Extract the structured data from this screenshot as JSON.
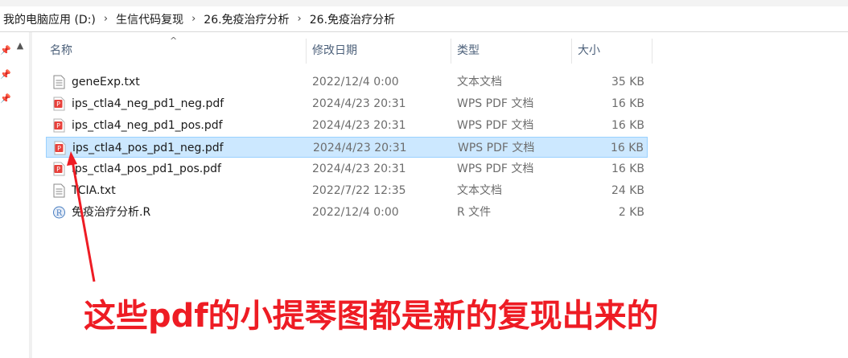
{
  "breadcrumb": {
    "items": [
      "我的电脑应用 (D:)",
      "生信代码复现",
      "26.免疫治疗分析",
      "26.免疫治疗分析"
    ],
    "separator": "›"
  },
  "columns": {
    "name": "名称",
    "date": "修改日期",
    "type": "类型",
    "size": "大小"
  },
  "files": [
    {
      "name": "geneExp.txt",
      "date": "2022/12/4 0:00",
      "type": "文本文档",
      "size": "35 KB",
      "icon": "text-file-icon",
      "selected": false
    },
    {
      "name": "ips_ctla4_neg_pd1_neg.pdf",
      "date": "2024/4/23 20:31",
      "type": "WPS PDF 文档",
      "size": "16 KB",
      "icon": "pdf-file-icon",
      "selected": false
    },
    {
      "name": "ips_ctla4_neg_pd1_pos.pdf",
      "date": "2024/4/23 20:31",
      "type": "WPS PDF 文档",
      "size": "16 KB",
      "icon": "pdf-file-icon",
      "selected": false
    },
    {
      "name": "ips_ctla4_pos_pd1_neg.pdf",
      "date": "2024/4/23 20:31",
      "type": "WPS PDF 文档",
      "size": "16 KB",
      "icon": "pdf-file-icon",
      "selected": true
    },
    {
      "name": "ips_ctla4_pos_pd1_pos.pdf",
      "date": "2024/4/23 20:31",
      "type": "WPS PDF 文档",
      "size": "16 KB",
      "icon": "pdf-file-icon",
      "selected": false
    },
    {
      "name": "TCIA.txt",
      "date": "2022/7/22 12:35",
      "type": "文本文档",
      "size": "24 KB",
      "icon": "text-file-icon",
      "selected": false
    },
    {
      "name": "免疫治疗分析.R",
      "date": "2022/12/4 0:00",
      "type": "R 文件",
      "size": "2 KB",
      "icon": "r-file-icon",
      "selected": false
    }
  ],
  "annotation": {
    "text": "这些pdf的小提琴图都是新的复现出来的",
    "color": "#ee1c24"
  },
  "colors": {
    "selection_bg": "#cce8ff",
    "selection_border": "#99d1ff",
    "header_text": "#4c607a",
    "pdf_red": "#e8413b",
    "r_blue": "#4a7fc1"
  }
}
